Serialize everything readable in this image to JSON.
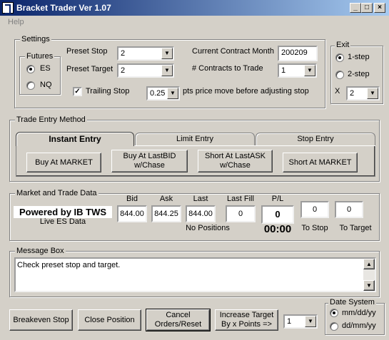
{
  "window": {
    "title": "Bracket Trader Ver 1.07",
    "controls": [
      "_",
      "□",
      "×"
    ]
  },
  "menu": {
    "help": "Help"
  },
  "settings": {
    "legend": "Settings",
    "futures": {
      "legend": "Futures",
      "options": [
        "ES",
        "NQ"
      ],
      "selected": "ES"
    },
    "preset_stop_label": "Preset Stop",
    "preset_stop_value": "2",
    "preset_target_label": "Preset Target",
    "preset_target_value": "2",
    "trailing_stop_label": "Trailing Stop",
    "trailing_stop_checked": "✓",
    "trailing_pts_value": "0.25",
    "trailing_pts_text": "pts price move before adjusting stop",
    "contract_month_label": "Current Contract Month",
    "contract_month_value": "200209",
    "contracts_label": "# Contracts to Trade",
    "contracts_value": "1"
  },
  "exit": {
    "legend": "Exit",
    "options": [
      "1-step",
      "2-step"
    ],
    "selected": "1-step",
    "x_label": "X",
    "x_value": "2"
  },
  "trade_entry": {
    "legend": "Trade Entry Method",
    "tabs": [
      "Instant Entry",
      "Limit Entry",
      "Stop Entry"
    ],
    "active_tab": "Instant Entry",
    "buttons": [
      "Buy At MARKET",
      "Buy At LastBID\nw/Chase",
      "Short At LastASK\nw/Chase",
      "Short At MARKET"
    ]
  },
  "market": {
    "legend": "Market and Trade Data",
    "powered_by": "Powered by IB TWS",
    "live_data": "Live ES Data",
    "bid_label": "Bid",
    "bid": "844.00",
    "ask_label": "Ask",
    "ask": "844.25",
    "last_label": "Last",
    "last": "844.00",
    "last_fill_label": "Last Fill",
    "last_fill": "0",
    "pl_label": "P/L",
    "pl": "0",
    "positions": "No Positions",
    "timer": "00:00",
    "to_stop_label": "To Stop",
    "to_stop": "0",
    "to_target_label": "To Target",
    "to_target": "0"
  },
  "message": {
    "legend": "Message Box",
    "text": "Check preset stop and target."
  },
  "bottom": {
    "breakeven": "Breakeven Stop",
    "close_position": "Close Position",
    "cancel": "Cancel\nOrders/Reset",
    "increase_target": "Increase Target\nBy x Points =>",
    "increase_value": "1"
  },
  "date_system": {
    "legend": "Date System",
    "options": [
      "mm/dd/yy",
      "dd/mm/yy"
    ],
    "selected": "mm/dd/yy"
  },
  "colors": {
    "title_start": "#0a246a",
    "title_end": "#a6caf0",
    "face": "#d4d0c8"
  }
}
